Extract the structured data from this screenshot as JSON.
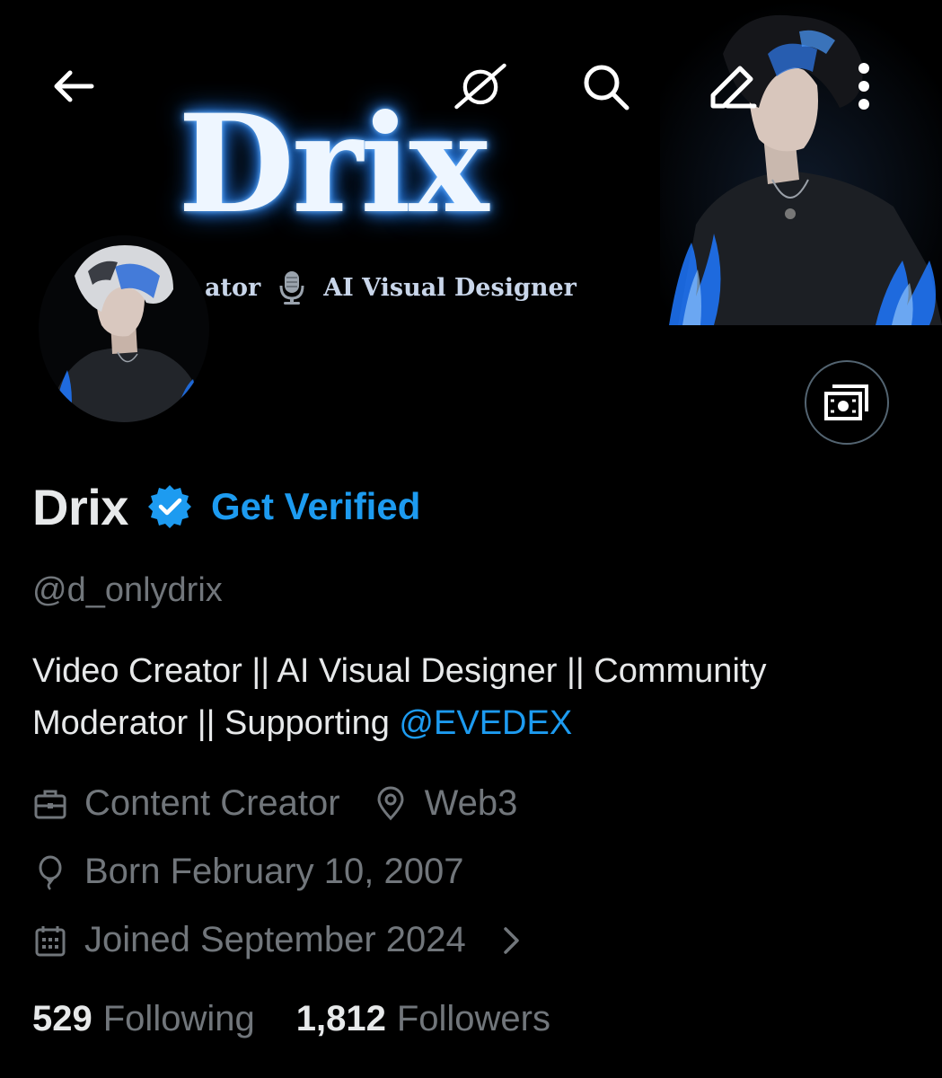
{
  "banner": {
    "title": "Drix",
    "subtitle_left": "ator",
    "subtitle_right": "AI Visual Designer"
  },
  "nav": {
    "back_icon": "arrow-left-icon",
    "grok_icon": "grok-icon",
    "search_icon": "search-icon",
    "edit_icon": "pencil-icon",
    "more_icon": "more-vertical-icon"
  },
  "profile": {
    "name": "Drix",
    "verify_cta": "Get Verified",
    "handle": "@d_onlydrix",
    "bio_text": "Video Creator || AI Visual Designer || Community Moderator || Supporting ",
    "bio_mention": "@EVEDEX",
    "category": "Content Creator",
    "location": "Web3",
    "birthday": "Born February 10, 2007",
    "joined": "Joined September 2024"
  },
  "stats": {
    "following_count": "529",
    "following_label": "Following",
    "followers_count": "1,812",
    "followers_label": "Followers"
  },
  "colors": {
    "background": "#000000",
    "accent": "#1d9bf0",
    "text_primary": "#e7e9ea",
    "text_secondary": "#71767b",
    "banner_glow": "#2f8cff"
  }
}
